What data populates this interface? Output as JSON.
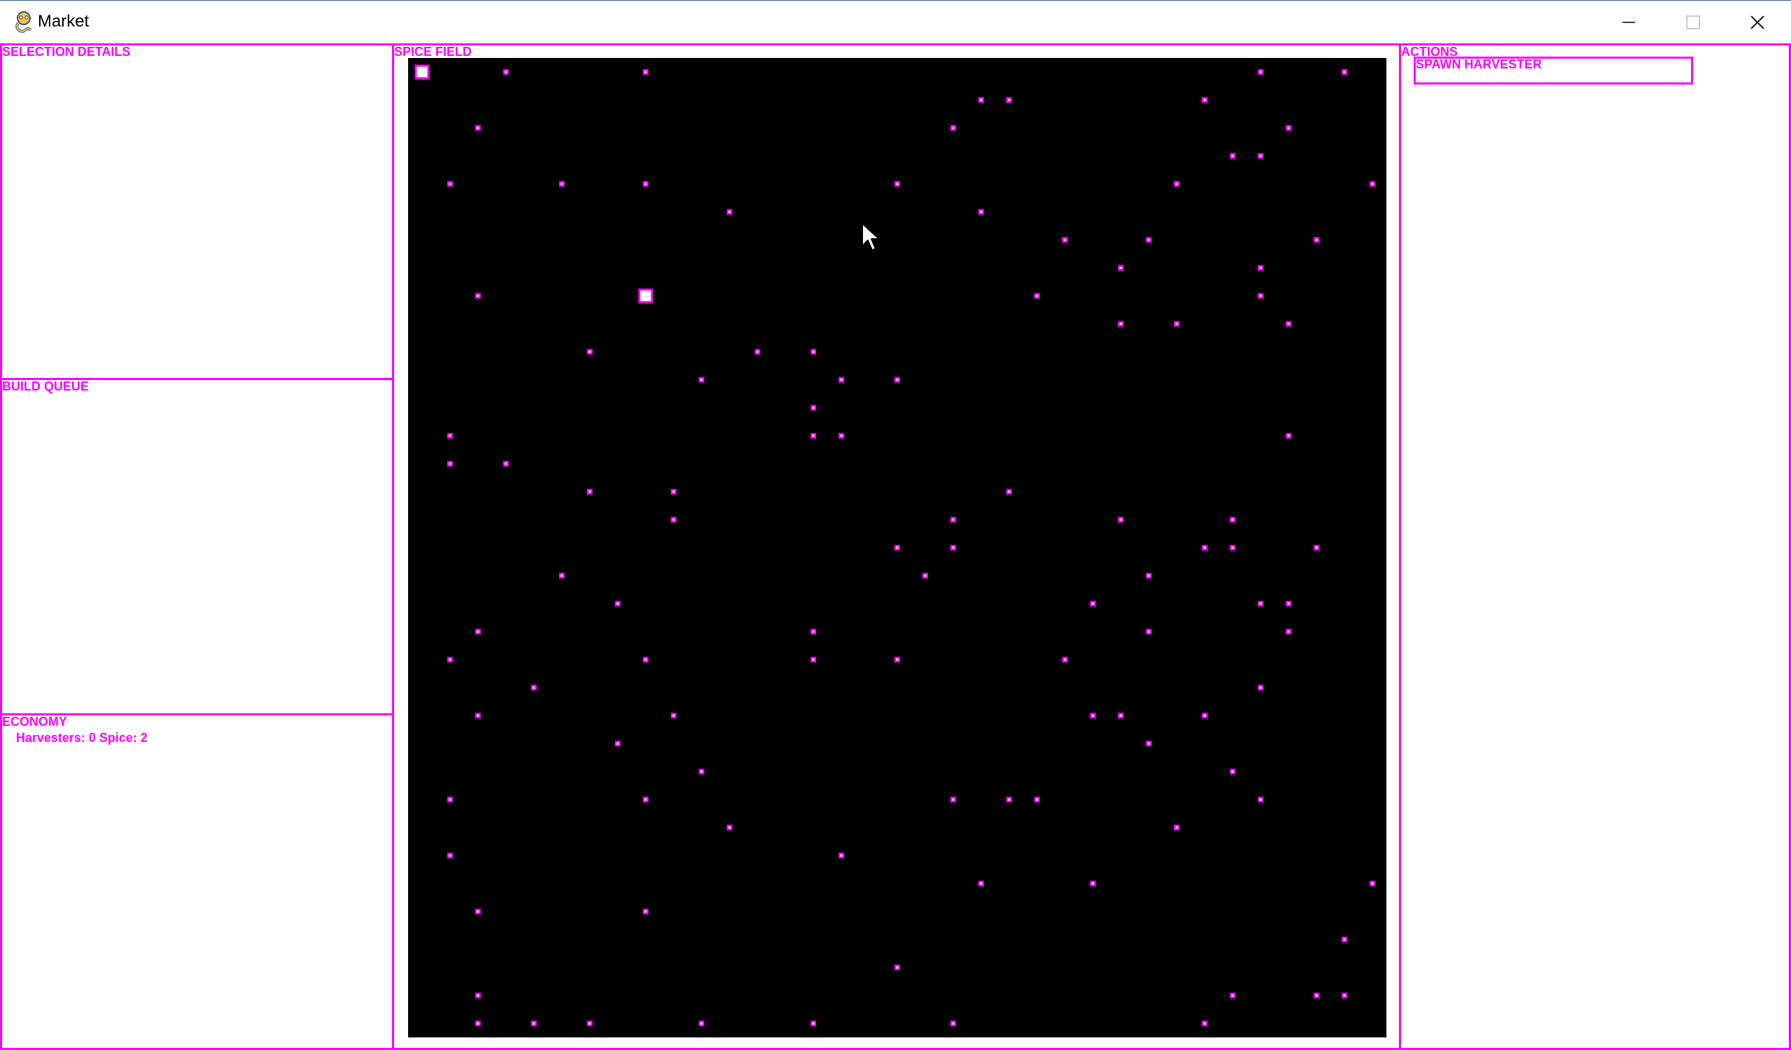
{
  "window": {
    "title": "Market",
    "icon": "pygame-snake-icon",
    "controls": [
      "minimize-icon",
      "maximize-icon",
      "close-icon"
    ]
  },
  "panels": {
    "selection_details": {
      "title": "SELECTION DETAILS"
    },
    "build_queue": {
      "title": "BUILD QUEUE"
    },
    "economy": {
      "title": "ECONOMY",
      "stats": "Harvesters: 0 Spice: 2"
    },
    "spice_field": {
      "title": "SPICE FIELD"
    },
    "actions": {
      "title": "ACTIONS",
      "spawn_harvester_label": "SPAWN HARVESTER"
    }
  },
  "colors": {
    "accent": "#ff00ff",
    "field_background": "#000000",
    "background": "#ffffff",
    "spice": "#ff00ff"
  },
  "spice_field": {
    "grid_columns": 35,
    "grid_rows": 35,
    "spice_cells": [
      [
        3,
        0
      ],
      [
        8,
        0
      ],
      [
        30,
        0
      ],
      [
        33,
        0
      ],
      [
        20,
        1
      ],
      [
        21,
        1
      ],
      [
        28,
        1
      ],
      [
        2,
        2
      ],
      [
        19,
        2
      ],
      [
        31,
        2
      ],
      [
        29,
        3
      ],
      [
        30,
        3
      ],
      [
        1,
        4
      ],
      [
        5,
        4
      ],
      [
        8,
        4
      ],
      [
        17,
        4
      ],
      [
        27,
        4
      ],
      [
        34,
        4
      ],
      [
        11,
        5
      ],
      [
        20,
        5
      ],
      [
        23,
        6
      ],
      [
        26,
        6
      ],
      [
        32,
        6
      ],
      [
        25,
        7
      ],
      [
        30,
        7
      ],
      [
        2,
        8
      ],
      [
        22,
        8
      ],
      [
        30,
        8
      ],
      [
        25,
        9
      ],
      [
        27,
        9
      ],
      [
        31,
        9
      ],
      [
        6,
        10
      ],
      [
        12,
        10
      ],
      [
        14,
        10
      ],
      [
        10,
        11
      ],
      [
        15,
        11
      ],
      [
        17,
        11
      ],
      [
        14,
        12
      ],
      [
        1,
        13
      ],
      [
        14,
        13
      ],
      [
        15,
        13
      ],
      [
        31,
        13
      ],
      [
        1,
        14
      ],
      [
        3,
        14
      ],
      [
        6,
        15
      ],
      [
        9,
        15
      ],
      [
        21,
        15
      ],
      [
        9,
        16
      ],
      [
        19,
        16
      ],
      [
        25,
        16
      ],
      [
        29,
        16
      ],
      [
        17,
        17
      ],
      [
        19,
        17
      ],
      [
        28,
        17
      ],
      [
        29,
        17
      ],
      [
        32,
        17
      ],
      [
        5,
        18
      ],
      [
        18,
        18
      ],
      [
        26,
        18
      ],
      [
        7,
        19
      ],
      [
        24,
        19
      ],
      [
        30,
        19
      ],
      [
        31,
        19
      ],
      [
        2,
        20
      ],
      [
        14,
        20
      ],
      [
        26,
        20
      ],
      [
        31,
        20
      ],
      [
        1,
        21
      ],
      [
        8,
        21
      ],
      [
        14,
        21
      ],
      [
        17,
        21
      ],
      [
        23,
        21
      ],
      [
        4,
        22
      ],
      [
        30,
        22
      ],
      [
        2,
        23
      ],
      [
        9,
        23
      ],
      [
        24,
        23
      ],
      [
        25,
        23
      ],
      [
        28,
        23
      ],
      [
        7,
        24
      ],
      [
        26,
        24
      ],
      [
        10,
        25
      ],
      [
        29,
        25
      ],
      [
        1,
        26
      ],
      [
        8,
        26
      ],
      [
        19,
        26
      ],
      [
        21,
        26
      ],
      [
        22,
        26
      ],
      [
        30,
        26
      ],
      [
        11,
        27
      ],
      [
        27,
        27
      ],
      [
        1,
        28
      ],
      [
        15,
        28
      ],
      [
        20,
        29
      ],
      [
        24,
        29
      ],
      [
        34,
        29
      ],
      [
        2,
        30
      ],
      [
        8,
        30
      ],
      [
        33,
        31
      ],
      [
        17,
        32
      ],
      [
        2,
        33
      ],
      [
        29,
        33
      ],
      [
        32,
        33
      ],
      [
        33,
        33
      ],
      [
        2,
        34
      ],
      [
        4,
        34
      ],
      [
        6,
        34
      ],
      [
        10,
        34
      ],
      [
        14,
        34
      ],
      [
        19,
        34
      ],
      [
        28,
        34
      ]
    ],
    "units": [
      {
        "type": "harvester",
        "cell": [
          0,
          0
        ]
      },
      {
        "type": "harvester",
        "cell": [
          8,
          8
        ]
      }
    ]
  }
}
